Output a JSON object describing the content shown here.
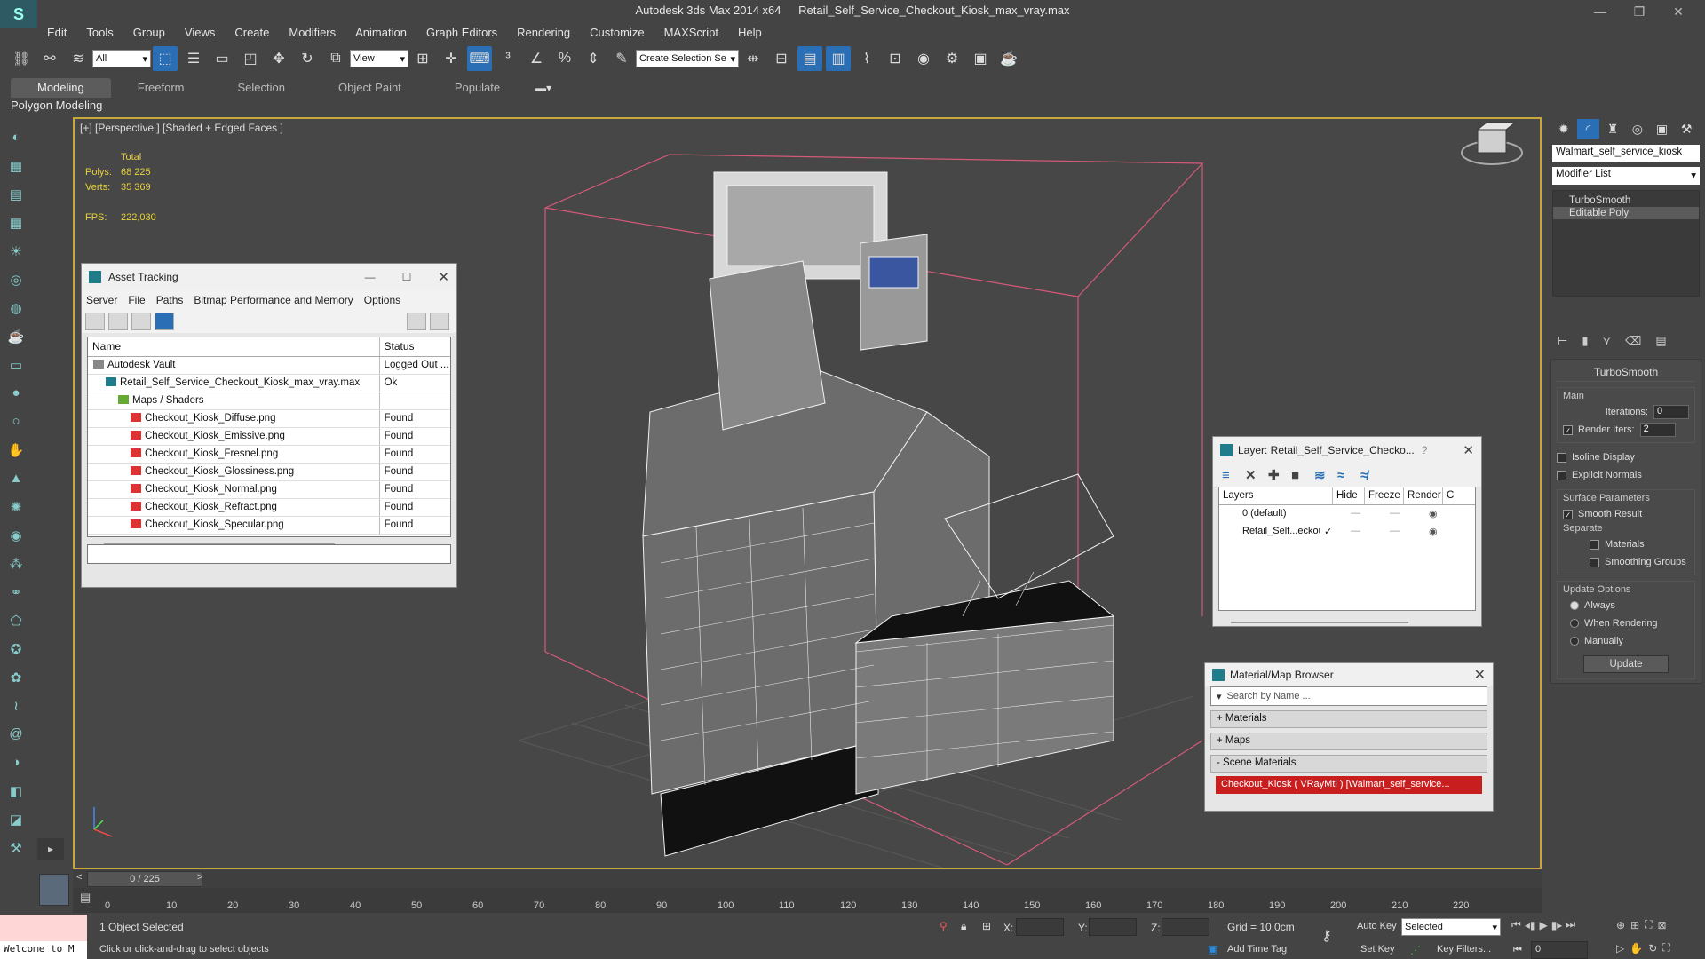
{
  "app": {
    "name": "Autodesk 3ds Max  2014 x64",
    "file": "Retail_Self_Service_Checkout_Kiosk_max_vray.max"
  },
  "menu": [
    "Edit",
    "Tools",
    "Group",
    "Views",
    "Create",
    "Modifiers",
    "Animation",
    "Graph Editors",
    "Rendering",
    "Customize",
    "MAXScript",
    "Help"
  ],
  "toolbar": {
    "filter": "All",
    "ref_coord": "View",
    "selection_set": "Create Selection Se"
  },
  "ribbon": {
    "tabs": [
      "Modeling",
      "Freeform",
      "Selection",
      "Object Paint",
      "Populate"
    ],
    "subpanel": "Polygon Modeling"
  },
  "viewport": {
    "label": "[+] [Perspective ] [Shaded + Edged Faces ]",
    "stats_header": "Total",
    "polys_label": "Polys:",
    "polys": "68 225",
    "verts_label": "Verts:",
    "verts": "35 369",
    "fps_label": "FPS:",
    "fps": "222,030"
  },
  "asset_tracking": {
    "title": "Asset Tracking",
    "menu": [
      "Server",
      "File",
      "Paths",
      "Bitmap Performance and Memory",
      "Options"
    ],
    "columns": [
      "Name",
      "Status"
    ],
    "rows": [
      {
        "name": "Autodesk Vault",
        "status": "Logged Out ...",
        "indent": 1,
        "icon": "vault"
      },
      {
        "name": "Retail_Self_Service_Checkout_Kiosk_max_vray.max",
        "status": "Ok",
        "indent": 2,
        "icon": "max"
      },
      {
        "name": "Maps / Shaders",
        "status": "",
        "indent": 3,
        "icon": "folder"
      },
      {
        "name": "Checkout_Kiosk_Diffuse.png",
        "status": "Found",
        "indent": 4,
        "icon": "png"
      },
      {
        "name": "Checkout_Kiosk_Emissive.png",
        "status": "Found",
        "indent": 4,
        "icon": "png"
      },
      {
        "name": "Checkout_Kiosk_Fresnel.png",
        "status": "Found",
        "indent": 4,
        "icon": "png"
      },
      {
        "name": "Checkout_Kiosk_Glossiness.png",
        "status": "Found",
        "indent": 4,
        "icon": "png"
      },
      {
        "name": "Checkout_Kiosk_Normal.png",
        "status": "Found",
        "indent": 4,
        "icon": "png"
      },
      {
        "name": "Checkout_Kiosk_Refract.png",
        "status": "Found",
        "indent": 4,
        "icon": "png"
      },
      {
        "name": "Checkout_Kiosk_Specular.png",
        "status": "Found",
        "indent": 4,
        "icon": "png"
      }
    ]
  },
  "layer_panel": {
    "title": "Layer: Retail_Self_Service_Checko...",
    "help": "?",
    "columns": [
      "Layers",
      "Hide",
      "Freeze",
      "Render",
      "C"
    ],
    "rows": [
      {
        "name": "0 (default)",
        "check": ""
      },
      {
        "name": "Retail_Self...eckout",
        "check": "✓"
      }
    ]
  },
  "material_browser": {
    "title": "Material/Map Browser",
    "search_placeholder": "Search by Name ...",
    "sections": [
      "+ Materials",
      "+ Maps",
      "- Scene Materials"
    ],
    "scene_material": "Checkout_Kiosk  ( VRayMtl ) [Walmart_self_service..."
  },
  "command_panel": {
    "object_name": "Walmart_self_service_kiosk",
    "modifier_list": "Modifier List",
    "stack": [
      "TurboSmooth",
      "Editable Poly"
    ],
    "turbosmooth": {
      "title": "TurboSmooth",
      "main": "Main",
      "iterations_label": "Iterations:",
      "iterations": "0",
      "render_iters_label": "Render Iters:",
      "render_iters": "2",
      "isoline": "Isoline Display",
      "explicit": "Explicit Normals",
      "surface": "Surface Parameters",
      "smooth_result": "Smooth Result",
      "separate": "Separate",
      "materials": "Materials",
      "smoothing_groups": "Smoothing Groups",
      "update_options": "Update Options",
      "always": "Always",
      "when_rendering": "When Rendering",
      "manually": "Manually",
      "update": "Update"
    }
  },
  "timeline": {
    "frame": "0 / 225",
    "ticks": [
      "0",
      "10",
      "20",
      "30",
      "40",
      "50",
      "60",
      "70",
      "80",
      "90",
      "100",
      "110",
      "120",
      "130",
      "140",
      "150",
      "160",
      "170",
      "180",
      "190",
      "200",
      "210",
      "220"
    ]
  },
  "status": {
    "maxscript": "Welcome to M",
    "selected": "1 Object Selected",
    "prompt": "Click or click-and-drag to select objects",
    "x_label": "X:",
    "y_label": "Y:",
    "z_label": "Z:",
    "grid": "Grid = 10,0cm",
    "auto_key": "Auto Key",
    "set_key": "Set Key",
    "key_mode": "Selected",
    "key_filters": "Key Filters...",
    "add_time_tag": "Add Time Tag",
    "frame_value": "0"
  }
}
